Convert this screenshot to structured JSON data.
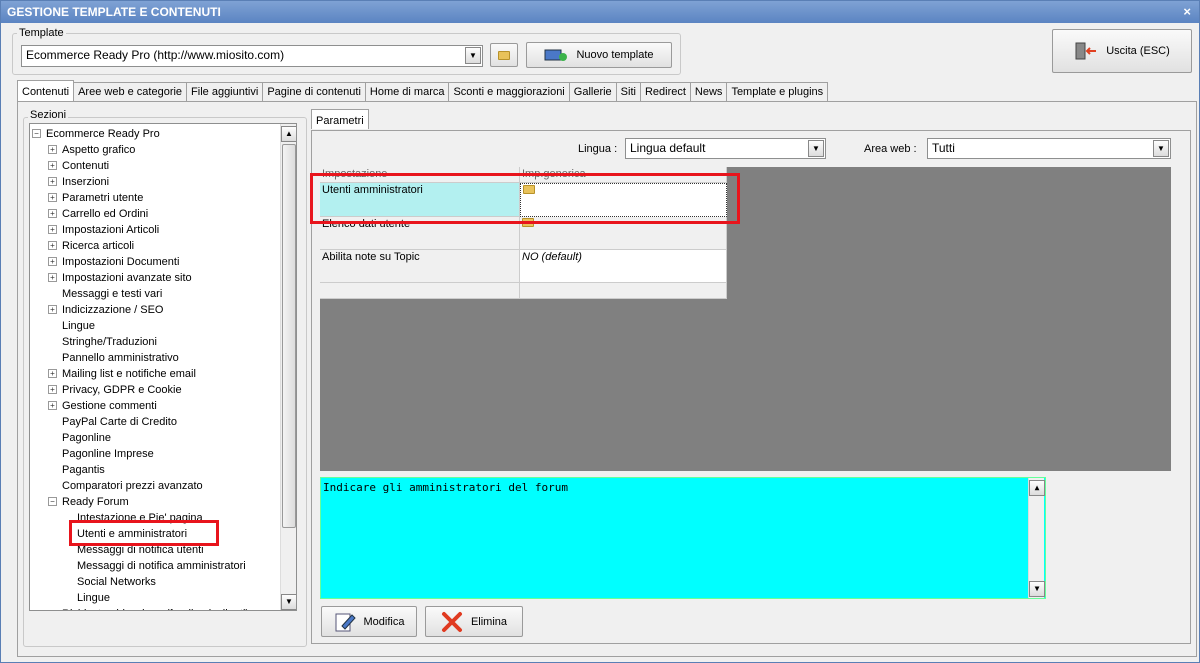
{
  "window": {
    "title": "GESTIONE TEMPLATE E CONTENUTI",
    "close": "×"
  },
  "template_group": {
    "label": "Template",
    "value": "Ecommerce Ready Pro (http://www.miosito.com)",
    "new_button": "Nuovo template"
  },
  "exit_button": "Uscita (ESC)",
  "tabs": [
    "Contenuti",
    "Aree web e categorie",
    "File aggiuntivi",
    "Pagine di contenuti",
    "Home di marca",
    "Sconti e maggiorazioni",
    "Gallerie",
    "Siti",
    "Redirect",
    "News",
    "Template e plugins"
  ],
  "sections": {
    "label": "Sezioni",
    "root": "Ecommerce Ready Pro",
    "items": [
      {
        "label": "Aspetto grafico",
        "expand": true
      },
      {
        "label": "Contenuti",
        "expand": true
      },
      {
        "label": "Inserzioni",
        "expand": true
      },
      {
        "label": "Parametri utente",
        "expand": true
      },
      {
        "label": "Carrello ed Ordini",
        "expand": true
      },
      {
        "label": "Impostazioni Articoli",
        "expand": true
      },
      {
        "label": "Ricerca articoli",
        "expand": true
      },
      {
        "label": "Impostazioni Documenti",
        "expand": true
      },
      {
        "label": "Impostazioni avanzate sito",
        "expand": true
      },
      {
        "label": "Messaggi e testi vari",
        "expand": false
      },
      {
        "label": "Indicizzazione / SEO",
        "expand": true
      },
      {
        "label": "Lingue",
        "expand": false
      },
      {
        "label": "Stringhe/Traduzioni",
        "expand": false
      },
      {
        "label": "Pannello amministrativo",
        "expand": false
      },
      {
        "label": "Mailing list e notifiche email",
        "expand": true
      },
      {
        "label": "Privacy, GDPR e Cookie",
        "expand": true
      },
      {
        "label": "Gestione commenti",
        "expand": true
      },
      {
        "label": "PayPal Carte di Credito",
        "expand": false
      },
      {
        "label": "Pagonline",
        "expand": false
      },
      {
        "label": "Pagonline Imprese",
        "expand": false
      },
      {
        "label": "Pagantis",
        "expand": false
      },
      {
        "label": "Comparatori prezzi avanzato",
        "expand": false
      },
      {
        "label": "Ready Forum",
        "expand": "open"
      }
    ],
    "forum_children": [
      "Intestazione e Pie' pagina",
      "Utenti e amministratori",
      "Messaggi di notifica utenti",
      "Messaggi di notifica amministratori",
      "Social Networks",
      "Lingue"
    ],
    "cut_item": "Richiesta ubicazione (feedback clienti)"
  },
  "parametri": {
    "tab": "Parametri",
    "lingua_label": "Lingua :",
    "lingua_value": "Lingua default",
    "area_label": "Area web :",
    "area_value": "Tutti",
    "headers": [
      "Impostazione",
      "Imp.generica"
    ],
    "rows": [
      {
        "name": "Utenti amministratori",
        "value": ""
      },
      {
        "name": "Elenco dati utente",
        "value": ""
      },
      {
        "name": "Abilita note su Topic",
        "value": "NO (default)"
      }
    ]
  },
  "memo_text": "Indicare gli amministratori del forum",
  "buttons": {
    "modifica": "Modifica",
    "elimina": "Elimina"
  },
  "colors": {
    "highlight": "#e8141c",
    "memo_bg": "#00ffff",
    "selected_row": "#b3f0f0"
  }
}
